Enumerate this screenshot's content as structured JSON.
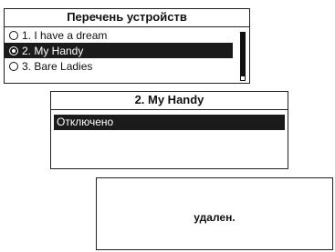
{
  "device_list": {
    "title": "Перечень устройств",
    "items": [
      {
        "label": "1. I have a dream",
        "selected": false
      },
      {
        "label": "2. My Handy",
        "selected": true
      },
      {
        "label": "3. Bare Ladies",
        "selected": false
      }
    ]
  },
  "device_detail": {
    "title": "2. My Handy",
    "option": "Отключено"
  },
  "message": {
    "text": "удален."
  }
}
